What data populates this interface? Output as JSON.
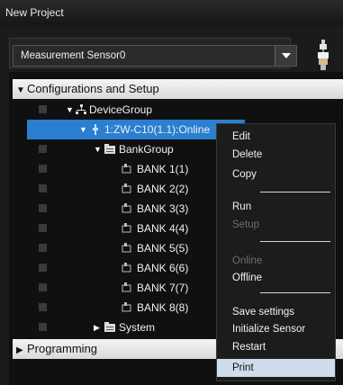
{
  "window": {
    "title": "New Project"
  },
  "sensor": {
    "selected": "Measurement Sensor0"
  },
  "sections": {
    "configurations": "Configurations and Setup",
    "programming": "Programming"
  },
  "tree": {
    "device_group": "DeviceGroup",
    "device": "1:ZW-C10(1.1):Online",
    "bank_group": "BankGroup",
    "banks": [
      "BANK 1(1)",
      "BANK 2(2)",
      "BANK 3(3)",
      "BANK 4(4)",
      "BANK 5(5)",
      "BANK 6(6)",
      "BANK 7(7)",
      "BANK 8(8)"
    ],
    "system": "System"
  },
  "context_menu": {
    "edit": "Edit",
    "delete": "Delete",
    "copy": "Copy",
    "run": "Run",
    "setup": "Setup",
    "online": "Online",
    "offline": "Offline",
    "save_settings": "Save settings",
    "initialize_sensor": "Initialize Sensor",
    "restart": "Restart",
    "print": "Print"
  },
  "colors": {
    "selection": "#2a7fd0",
    "menu_highlight": "#cfdcec",
    "background": "#1b1b1b"
  }
}
